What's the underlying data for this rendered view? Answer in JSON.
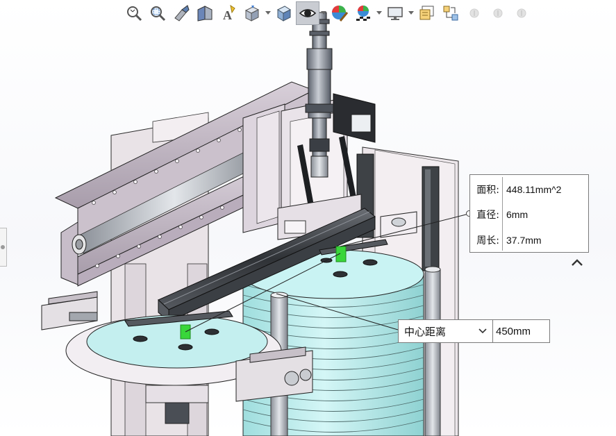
{
  "toolbar": {
    "items": [
      {
        "name": "zoom-to-fit",
        "icon": "zoom-fit-icon",
        "active": false,
        "dropdown": false
      },
      {
        "name": "zoom-to-area",
        "icon": "zoom-area-icon",
        "active": false,
        "dropdown": false
      },
      {
        "name": "previous-view",
        "icon": "previous-view-icon",
        "active": false,
        "dropdown": false
      },
      {
        "name": "section-view",
        "icon": "section-view-icon",
        "active": false,
        "dropdown": false
      },
      {
        "name": "dynamic-annotation-views",
        "icon": "annotation-view-icon",
        "active": false,
        "dropdown": false
      },
      {
        "name": "view-orientation",
        "icon": "view-orientation-icon",
        "active": false,
        "dropdown": true
      },
      {
        "name": "display-style",
        "icon": "display-style-icon",
        "active": false,
        "dropdown": false
      },
      {
        "name": "hide-show-items",
        "icon": "eye-icon",
        "active": true,
        "dropdown": true
      },
      {
        "name": "edit-appearance",
        "icon": "appearance-icon",
        "active": false,
        "dropdown": false
      },
      {
        "name": "apply-scene",
        "icon": "scene-icon",
        "active": false,
        "dropdown": true
      },
      {
        "name": "view-settings",
        "icon": "monitor-icon",
        "active": false,
        "dropdown": true
      },
      {
        "name": "display-pane",
        "icon": "display-pane-icon",
        "active": false,
        "dropdown": false
      },
      {
        "name": "link-views",
        "icon": "link-views-icon",
        "active": false,
        "dropdown": false
      },
      {
        "name": "disabled-1",
        "icon": "info-disabled-icon",
        "active": false,
        "dropdown": false
      },
      {
        "name": "disabled-2",
        "icon": "info-disabled-icon",
        "active": false,
        "dropdown": false
      },
      {
        "name": "disabled-3",
        "icon": "info-disabled-icon",
        "active": false,
        "dropdown": false
      }
    ]
  },
  "measure": {
    "rows": [
      {
        "key": "面积:",
        "value": "448.11mm^2"
      },
      {
        "key": "直径:",
        "value": "6mm"
      },
      {
        "key": "周长:",
        "value": "37.7mm"
      }
    ],
    "collapse_icon": "chevron-up-icon"
  },
  "distance": {
    "mode": "中心距离",
    "value": "450mm"
  },
  "colors": {
    "frame": "#e8e2e6",
    "frame_dark": "#b8aebb",
    "rail": "#c4b8c6",
    "cyan": "#b9ecec",
    "highlight_green": "#39d63a",
    "metal": "#a4a9b4",
    "dark_profile": "#3d4045"
  }
}
